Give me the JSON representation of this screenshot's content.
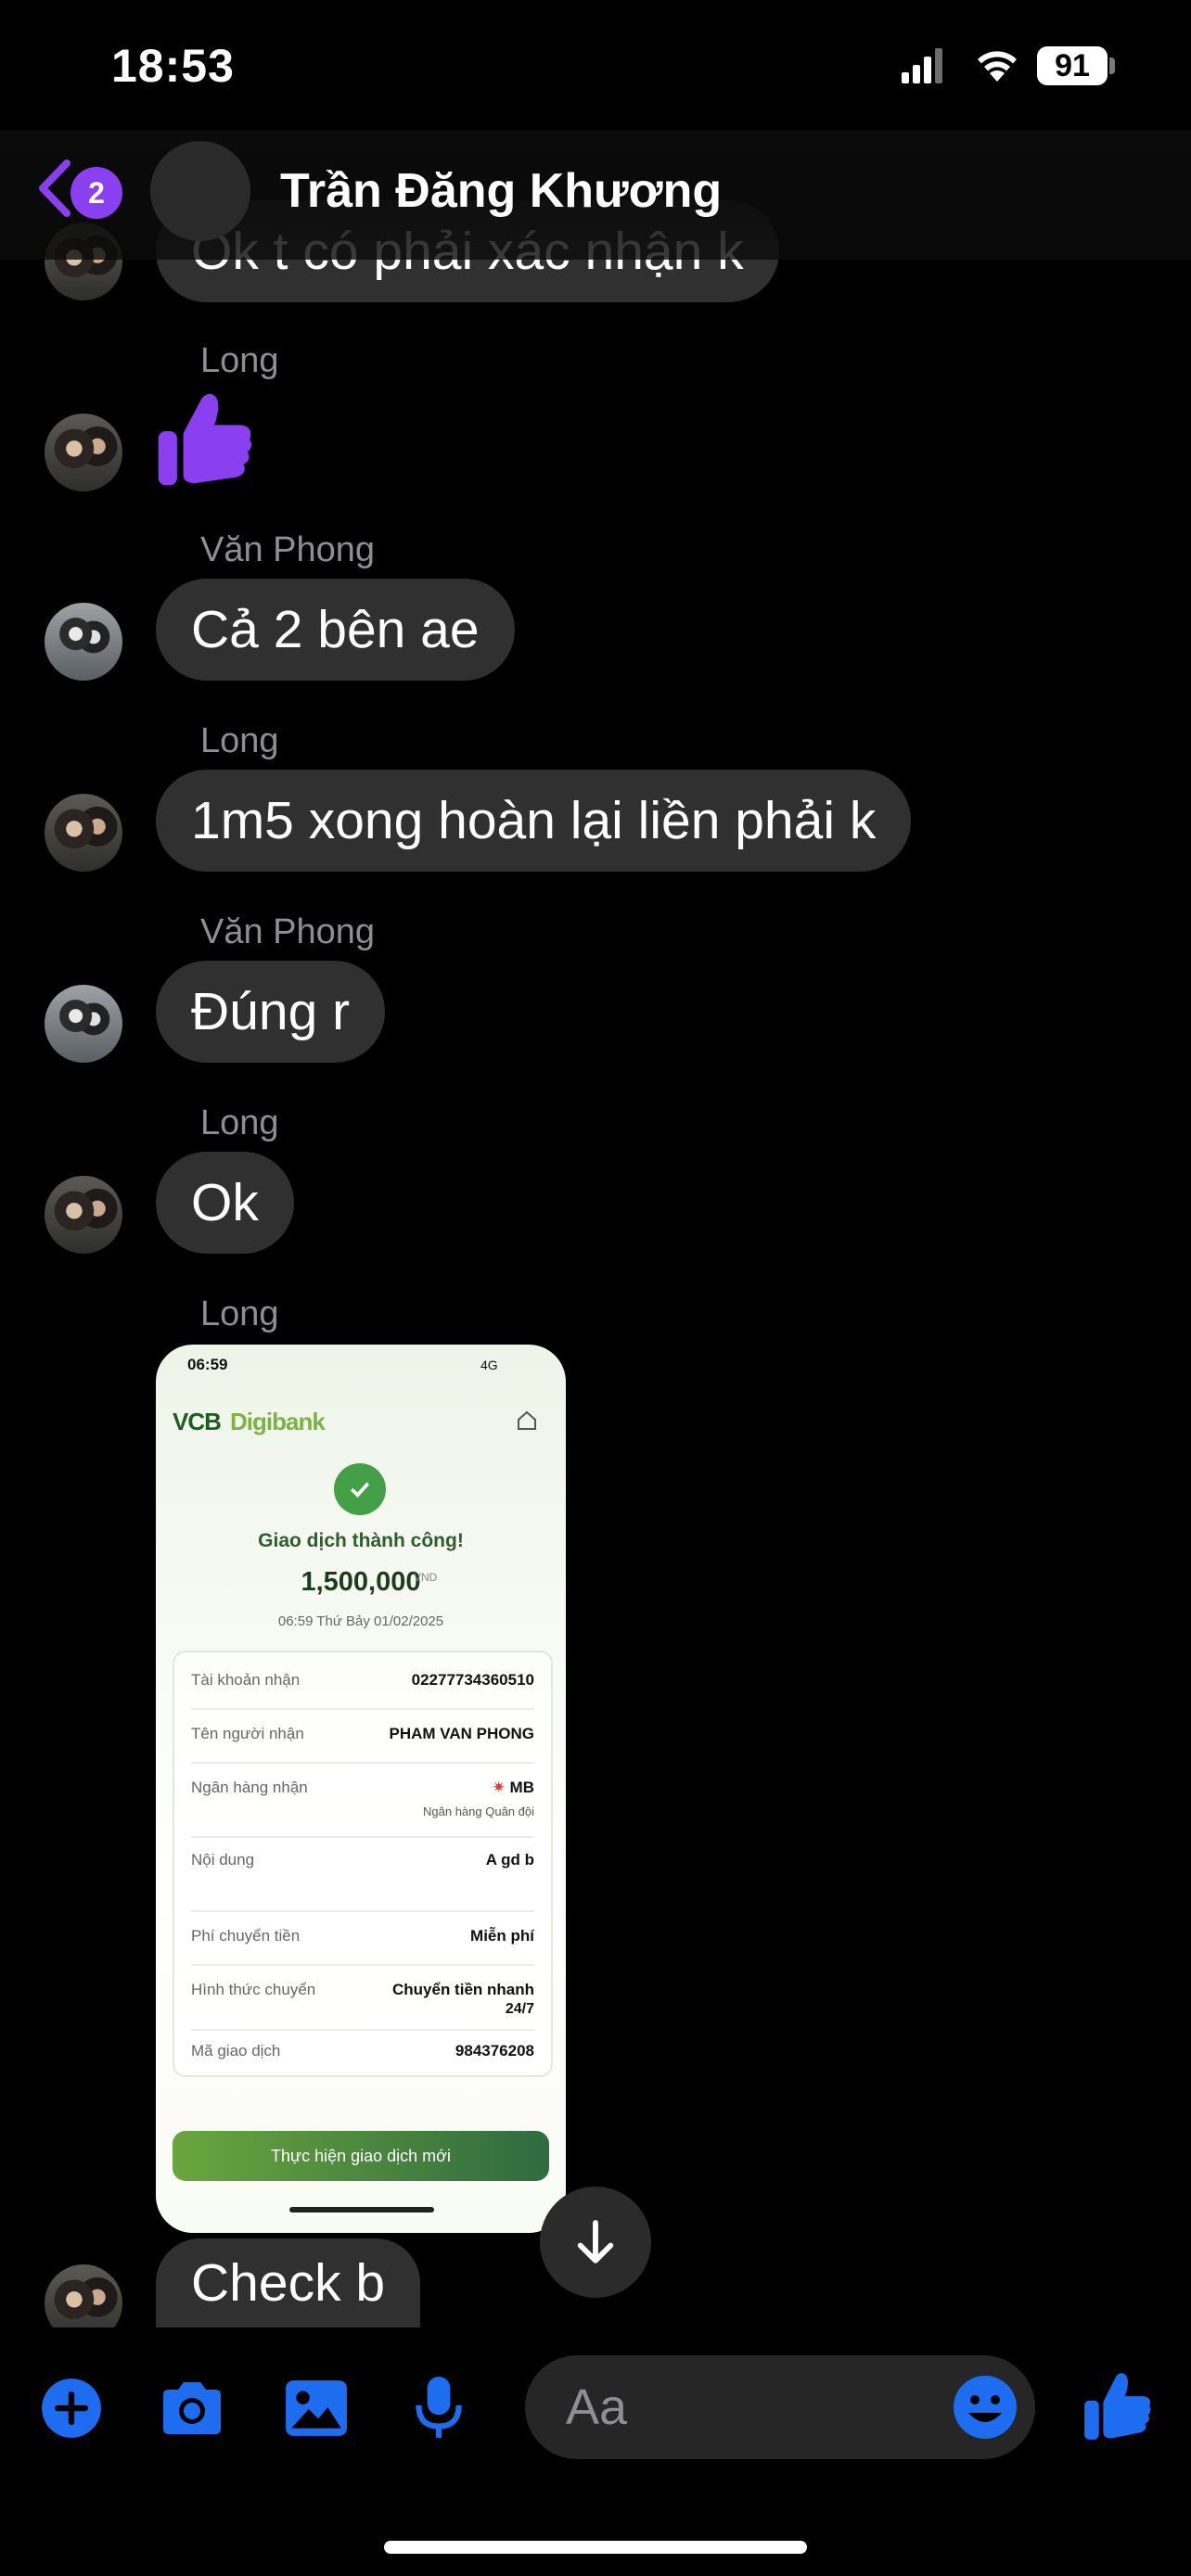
{
  "status_bar": {
    "time": "18:53",
    "battery": "91"
  },
  "header": {
    "unread_count": "2",
    "title": "Trần Đăng Khương"
  },
  "colors": {
    "accent": "#8a3ff0",
    "action_blue": "#1e6df0",
    "bubble": "#303030"
  },
  "messages": [
    {
      "type": "text",
      "sender": "",
      "avatar": "long",
      "text": "Ok t có phải xác nhận k"
    },
    {
      "type": "thumbs_up",
      "sender": "Long",
      "avatar": "long"
    },
    {
      "type": "text",
      "sender": "Văn Phong",
      "avatar": "phong",
      "text": "Cả 2 bên ae"
    },
    {
      "type": "text",
      "sender": "Long",
      "avatar": "long",
      "text": "1m5 xong hoàn lại liền phải k"
    },
    {
      "type": "text",
      "sender": "Văn Phong",
      "avatar": "phong",
      "text": "Đúng r"
    },
    {
      "type": "text",
      "sender": "Long",
      "avatar": "long",
      "text": "Ok"
    },
    {
      "type": "image",
      "sender": "Long",
      "avatar": "long"
    },
    {
      "type": "text",
      "sender": "",
      "avatar": "long",
      "text": "Check b"
    }
  ],
  "receipt": {
    "time": "06:59",
    "network": "4G",
    "brand_a": "VCB",
    "brand_b": "Digibank",
    "success": "Giao dịch thành công!",
    "amount": "1,500,000",
    "currency": "VND",
    "datetime": "06:59 Thứ Bảy 01/02/2025",
    "rows": [
      {
        "label": "Tài khoản nhận",
        "value": "02277734360510"
      },
      {
        "label": "Tên người nhận",
        "value": "PHAM VAN PHONG"
      },
      {
        "label": "Ngân hàng nhận",
        "value": "MB",
        "sub": "Ngân hàng Quân đội"
      },
      {
        "label": "Nội dung",
        "value": "A gd b"
      },
      {
        "label": "Phí chuyển tiền",
        "value": "Miễn phí"
      },
      {
        "label": "Hình thức chuyển",
        "value": "Chuyển tiền nhanh",
        "sub": "24/7"
      },
      {
        "label": "Mã giao dịch",
        "value": "984376208"
      }
    ],
    "new_transaction": "Thực hiện giao dịch mới"
  },
  "composer": {
    "placeholder": "Aa"
  }
}
